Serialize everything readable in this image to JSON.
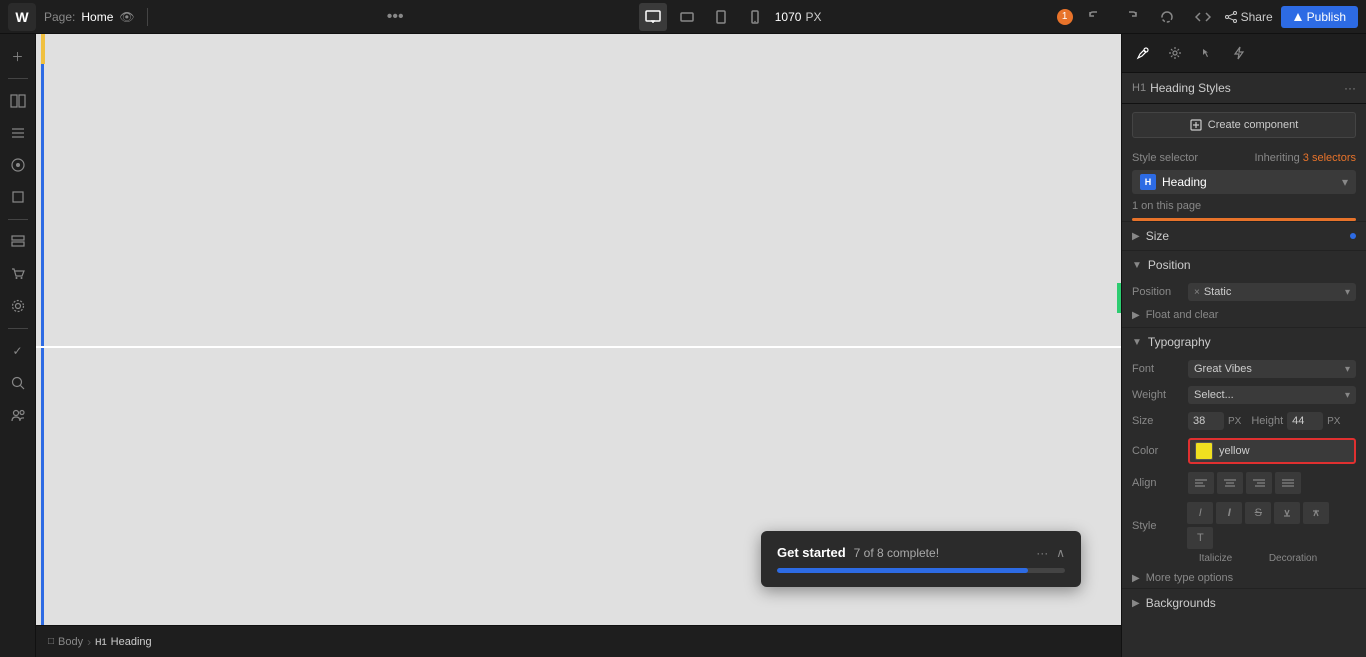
{
  "topbar": {
    "logo": "W",
    "page_label": "Page:",
    "page_name": "Home",
    "dots_label": "•••",
    "px_value": "1070",
    "px_unit": "PX",
    "badge_count": "1",
    "share_label": "Share",
    "publish_label": "Publish"
  },
  "breadcrumb": {
    "items": [
      {
        "icon": "□",
        "label": "Body"
      },
      {
        "icon": "H1",
        "label": "Heading"
      }
    ]
  },
  "panel": {
    "h1_tag": "H1",
    "title": "Heading Styles",
    "menu": "···",
    "create_component": "Create component",
    "style_selector_label": "Style selector",
    "inherit_text": "Inheriting",
    "selectors_count": "3 selectors",
    "style_icon_label": "H",
    "style_name": "Heading",
    "on_this_page": "1 on this page",
    "size_section": {
      "label": "Size",
      "has_dot": true
    },
    "position_section": {
      "label": "Position",
      "position_label": "Position",
      "position_x": "×",
      "position_value": "Static",
      "float_label": "Float and clear"
    },
    "typography_section": {
      "label": "Typography",
      "font_label": "Font",
      "font_value": "Great Vibes",
      "weight_label": "Weight",
      "weight_value": "Select...",
      "size_label": "Size",
      "size_value": "38",
      "size_unit": "PX",
      "height_label": "Height",
      "height_value": "44",
      "height_unit": "PX",
      "color_label": "Color",
      "color_name": "yellow",
      "align_label": "Align",
      "style_label": "Style",
      "italicize_label": "Italicize",
      "decoration_label": "Decoration",
      "more_type_label": "More type options"
    },
    "backgrounds_section": {
      "label": "Backgrounds"
    }
  },
  "get_started": {
    "title": "Get started",
    "progress_text": "7 of 8 complete!",
    "progress_pct": 87,
    "dots": "···",
    "chevron": "∧"
  },
  "left_sidebar": {
    "items": [
      {
        "icon": "+"
      },
      {
        "icon": "◧"
      },
      {
        "icon": "≡"
      },
      {
        "icon": "⊕"
      },
      {
        "icon": "◻"
      },
      {
        "icon": "☁"
      },
      {
        "icon": "👤"
      },
      {
        "icon": "🛒"
      },
      {
        "icon": "⚙"
      },
      {
        "icon": "✓"
      },
      {
        "icon": "🔍"
      },
      {
        "icon": "👥"
      }
    ]
  }
}
